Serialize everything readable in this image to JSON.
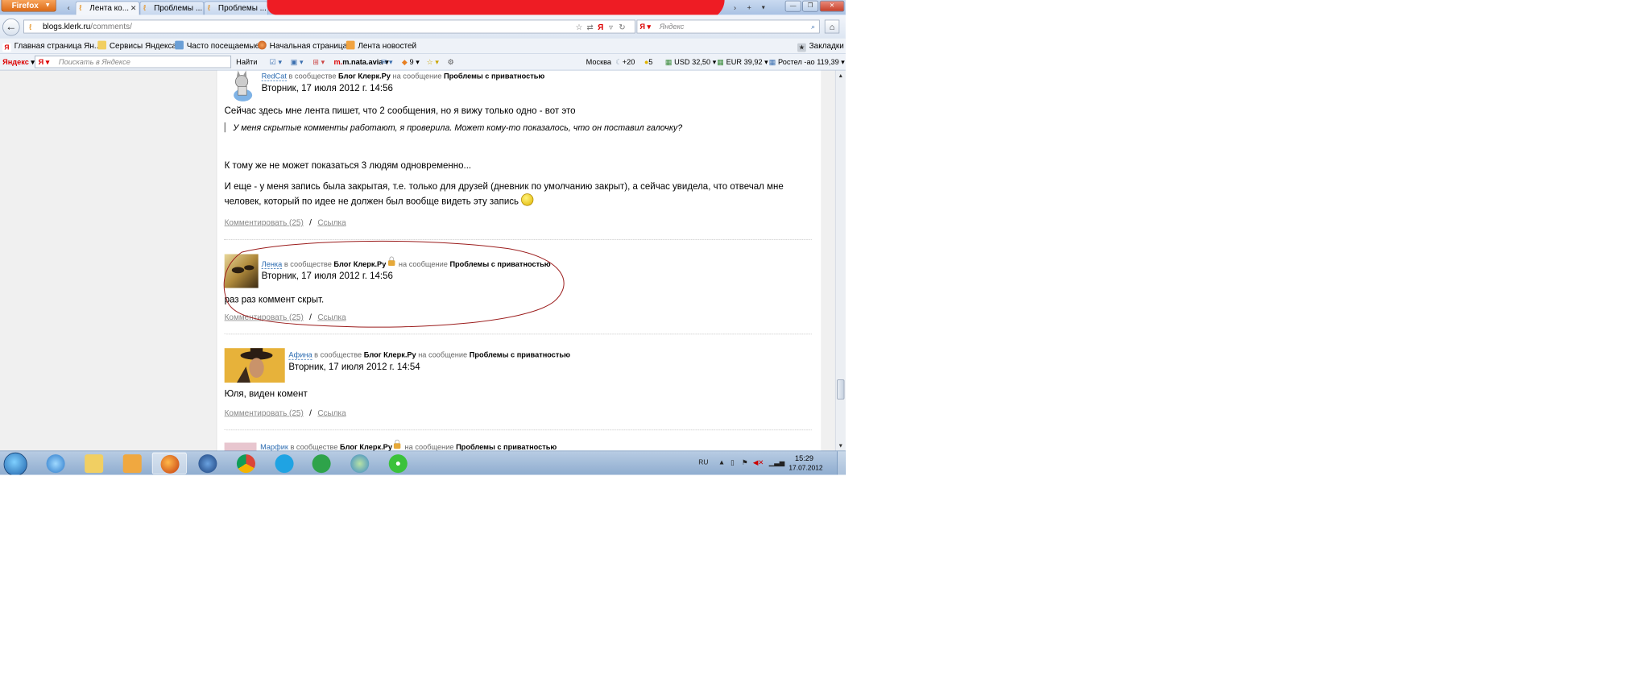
{
  "browser": {
    "menu_button": "Firefox",
    "tabs": [
      {
        "label": "Лента ко...",
        "active": true
      },
      {
        "label": "Проблемы ...",
        "active": false
      },
      {
        "label": "Проблемы ...",
        "active": false
      }
    ],
    "url": {
      "domain": "blogs.klerk.ru",
      "path": "/comments/"
    },
    "search_placeholder": "Яндекс",
    "bookmarks": [
      {
        "label": "Главная страница Ян..."
      },
      {
        "label": "Сервисы Яндекса"
      },
      {
        "label": "Часто посещаемые"
      },
      {
        "label": "Начальная страница"
      },
      {
        "label": "Лента новостей"
      }
    ],
    "bookmarks_menu": "Закладки"
  },
  "yandex_bar": {
    "logo": "Яндекс",
    "search_placeholder": "Поискать в Яндексе",
    "find_button": "Найти",
    "mail_label": "m.nata.avia",
    "counter": "9",
    "city": "Москва",
    "weather": "+20",
    "traffic": "5",
    "usd": "USD 32,50",
    "eur": "EUR 39,92",
    "stock": "Ростел -ао 119,39"
  },
  "posts": [
    {
      "author": "RedCat",
      "in_community": "в сообществе",
      "community": "Блог Клерк.Ру",
      "on_post": "на сообщение",
      "post_title": "Проблемы с приватностью",
      "date": "Вторник, 17 июля 2012 г. 14:56",
      "paragraph1": "Сейчас здесь мне лента пишет, что 2 сообщения, но я вижу только одно - вот это",
      "quote": "У меня скрытые комменты работают, я проверила. Может кому-то показалось, что он поставил галочку?",
      "paragraph2": "К тому же не может показаться 3 людям одновременно...",
      "paragraph3a": "И еще - у меня запись была закрытая, т.е. только для друзей (дневник по умолчанию закрыт), а сейчас увидела, что отвечал мне",
      "paragraph3b": "человек, который по идее не должен был вообще видеть эту запись",
      "comment_link": "Комментировать (25)",
      "link": "Ссылка"
    },
    {
      "author": "Ленка",
      "in_community": "в сообществе",
      "community": "Блог Клерк.Ру",
      "on_post": "на сообщение",
      "post_title": "Проблемы с приватностью",
      "date": "Вторник, 17 июля 2012 г. 14:56",
      "text": "раз раз коммент скрыт.",
      "comment_link": "Комментировать (25)",
      "link": "Ссылка"
    },
    {
      "author": "Афина",
      "in_community": "в сообществе",
      "community": "Блог Клерк.Ру",
      "on_post": "на сообщение",
      "post_title": "Проблемы с приватностью",
      "date": "Вторник, 17 июля 2012 г. 14:54",
      "text": "Юля, виден комент",
      "comment_link": "Комментировать (25)",
      "link": "Ссылка"
    },
    {
      "author": "Марфик",
      "in_community": "в сообществе",
      "community": "Блог Клерк.Ру",
      "on_post": "на сообщение",
      "post_title": "Проблемы с приватностью"
    }
  ],
  "link_separator": "/",
  "taskbar": {
    "lang": "RU",
    "time": "15:29",
    "date": "17.07.2012"
  },
  "colors": {
    "link": "#2a6ab0",
    "annotation": "#9b1c1c",
    "firefox_button": "#dd6a16"
  }
}
